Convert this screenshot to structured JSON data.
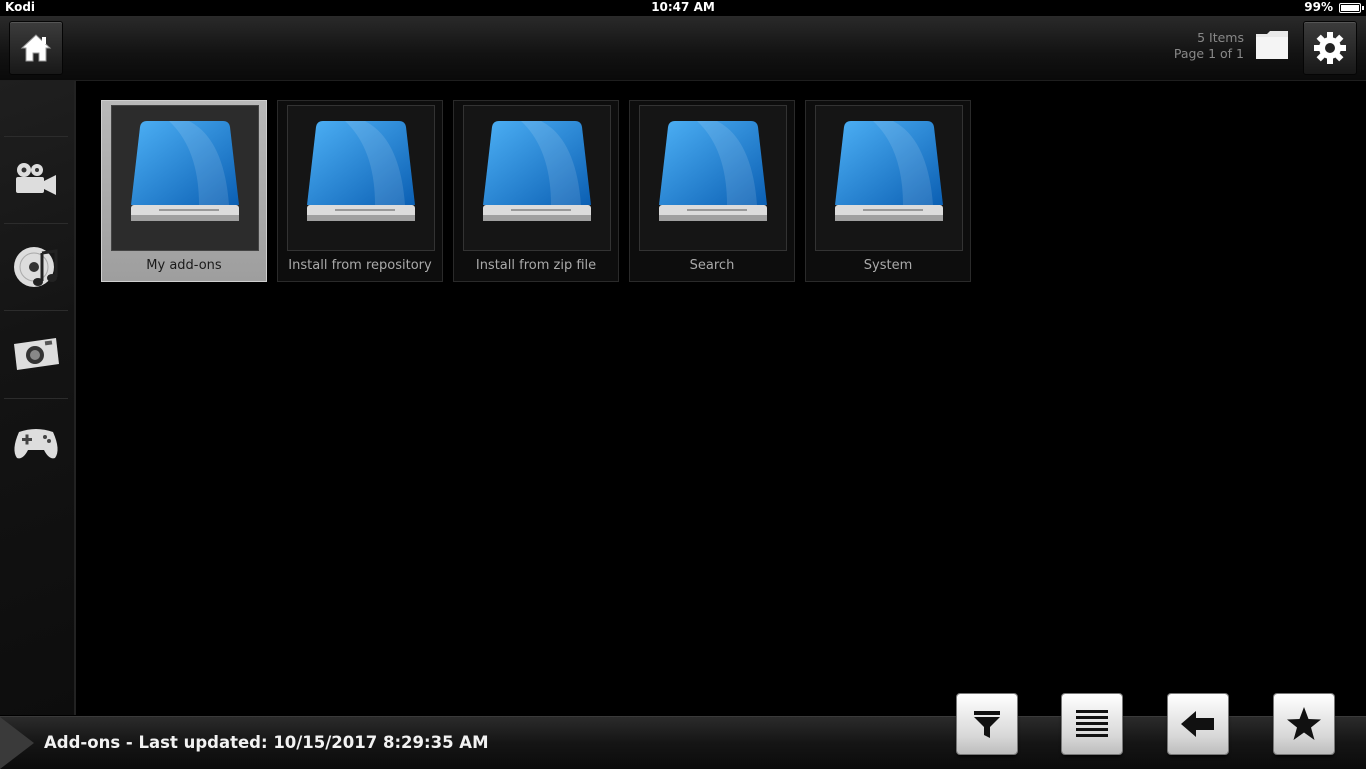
{
  "status_bar": {
    "app_name": "Kodi",
    "time": "10:47 AM",
    "battery_percent": "99%",
    "battery_level": 0.99
  },
  "header": {
    "items_count": "5 Items",
    "page_info": "Page 1 of 1",
    "icons": {
      "home": "home-icon",
      "folder": "folder-icon",
      "settings": "gear-icon"
    }
  },
  "sidebar": {
    "items": [
      {
        "name": "videos",
        "icon": "video-camera-icon"
      },
      {
        "name": "music",
        "icon": "music-disc-icon"
      },
      {
        "name": "pictures",
        "icon": "photo-camera-icon"
      },
      {
        "name": "games",
        "icon": "gamepad-icon"
      }
    ]
  },
  "grid": {
    "items": [
      {
        "label": "My add-ons",
        "selected": true
      },
      {
        "label": "Install from repository",
        "selected": false
      },
      {
        "label": "Install from zip file",
        "selected": false
      },
      {
        "label": "Search",
        "selected": false
      },
      {
        "label": "System",
        "selected": false
      }
    ]
  },
  "footer": {
    "title": "Add-ons - Last updated: 10/15/2017 8:29:35 AM",
    "buttons": [
      {
        "name": "filter",
        "icon": "filter-icon"
      },
      {
        "name": "view",
        "icon": "list-icon"
      },
      {
        "name": "back",
        "icon": "back-arrow-icon"
      },
      {
        "name": "favourites",
        "icon": "star-icon"
      }
    ]
  },
  "colors": {
    "accent_blue": "#1a8de0",
    "selected_tile": "#b3b3b3",
    "background": "#000000"
  }
}
